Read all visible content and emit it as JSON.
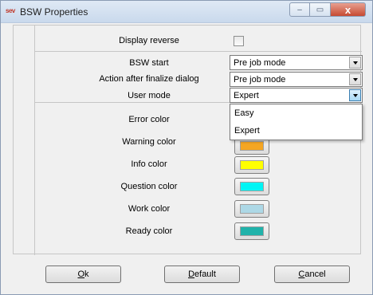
{
  "window": {
    "title": "BSW Properties",
    "app_icon_text": "sev",
    "minimize_glyph": "–",
    "maximize_glyph": "▭",
    "close_glyph": "x"
  },
  "settings": {
    "display_reverse": {
      "label": "Display reverse",
      "checked": false
    },
    "bsw_start": {
      "label": "BSW start",
      "value": "Pre job mode"
    },
    "action_after_finalize": {
      "label": "Action after finalize dialog",
      "value": "Pre job mode"
    },
    "user_mode": {
      "label": "User mode",
      "value": "Expert",
      "options": [
        "Easy",
        "Expert"
      ],
      "open": true
    }
  },
  "colors": [
    {
      "label": "Error color",
      "hex": ""
    },
    {
      "label": "Warning color",
      "hex": "#f5a623"
    },
    {
      "label": "Info color",
      "hex": "#ffff00"
    },
    {
      "label": "Question color",
      "hex": "#00f5f5"
    },
    {
      "label": "Work color",
      "hex": "#add8e6"
    },
    {
      "label": "Ready color",
      "hex": "#20b2aa"
    }
  ],
  "buttons": {
    "ok": {
      "mnemonic": "O",
      "rest": "k"
    },
    "default": {
      "mnemonic": "D",
      "rest": "efault"
    },
    "cancel": {
      "mnemonic": "C",
      "rest": "ancel"
    }
  }
}
